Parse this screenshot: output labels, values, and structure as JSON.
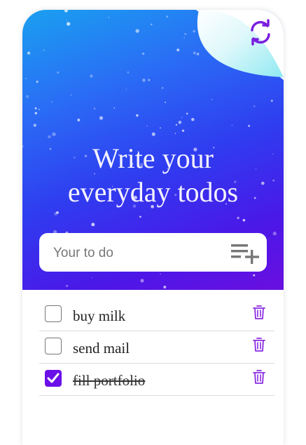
{
  "hero": {
    "headline_line1": "Write your",
    "headline_line2": "everyday todos"
  },
  "input": {
    "placeholder": "Your to do",
    "value": ""
  },
  "icons": {
    "refresh": "refresh-icon",
    "curl": "page-curl",
    "add": "playlist-add-icon",
    "check": "check-icon",
    "trash": "trash-icon"
  },
  "colors": {
    "accent": "#6b0fe8",
    "hero_top": "#1aa0f0",
    "hero_bottom": "#6a0fe0"
  },
  "todos": [
    {
      "text": "buy milk",
      "done": false
    },
    {
      "text": "send mail",
      "done": false
    },
    {
      "text": "fill portfolio",
      "done": true
    }
  ]
}
